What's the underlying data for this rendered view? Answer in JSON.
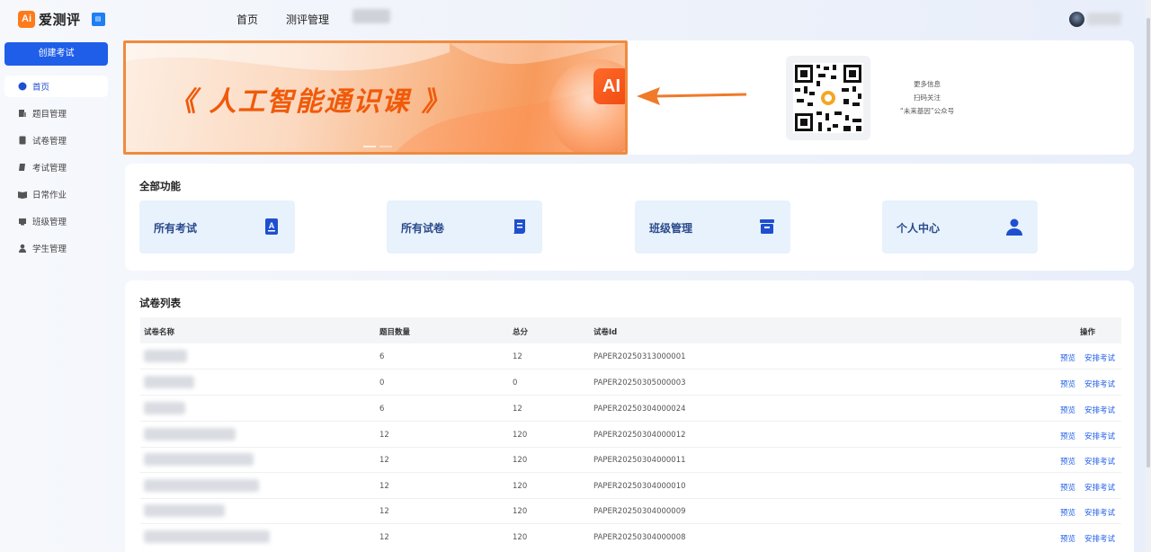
{
  "header": {
    "logo_mark": "Ai",
    "app_name": "爱测评",
    "nav": [
      {
        "label": "首页"
      },
      {
        "label": "测评管理"
      }
    ]
  },
  "sidebar": {
    "create_button": "创建考试",
    "items": [
      {
        "label": "首页",
        "icon": "home-icon",
        "active": true
      },
      {
        "label": "题目管理",
        "icon": "question-bank-icon"
      },
      {
        "label": "试卷管理",
        "icon": "paper-icon"
      },
      {
        "label": "考试管理",
        "icon": "exam-icon"
      },
      {
        "label": "日常作业",
        "icon": "homework-icon"
      },
      {
        "label": "班级管理",
        "icon": "class-icon"
      },
      {
        "label": "学生管理",
        "icon": "student-icon"
      }
    ]
  },
  "banner": {
    "title": "《 人工智能通识课 》",
    "badge": "AI"
  },
  "qr_panel": {
    "lines": [
      "更多信息",
      "扫码关注",
      "“未来基因”公众号"
    ]
  },
  "functions": {
    "title": "全部功能",
    "tiles": [
      {
        "label": "所有考试",
        "icon": "exam-doc-icon"
      },
      {
        "label": "所有试卷",
        "icon": "scroll-icon"
      },
      {
        "label": "班级管理",
        "icon": "class-box-icon"
      },
      {
        "label": "个人中心",
        "icon": "user-icon"
      }
    ]
  },
  "paper_list": {
    "title": "试卷列表",
    "columns": [
      "试卷名称",
      "题目数量",
      "总分",
      "试卷Id",
      "操作"
    ],
    "action_preview": "预览",
    "action_schedule": "安排考试",
    "rows": [
      {
        "count": "6",
        "score": "12",
        "id": "PAPER20250313000001"
      },
      {
        "count": "0",
        "score": "0",
        "id": "PAPER20250305000003"
      },
      {
        "count": "6",
        "score": "12",
        "id": "PAPER20250304000024"
      },
      {
        "count": "12",
        "score": "120",
        "id": "PAPER20250304000012"
      },
      {
        "count": "12",
        "score": "120",
        "id": "PAPER20250304000011"
      },
      {
        "count": "12",
        "score": "120",
        "id": "PAPER20250304000010"
      },
      {
        "count": "12",
        "score": "120",
        "id": "PAPER20250304000009"
      },
      {
        "count": "12",
        "score": "120",
        "id": "PAPER20250304000008"
      }
    ]
  },
  "colors": {
    "primary": "#1f5ee8",
    "brand_orange": "#ff7a1a",
    "tile_bg": "#e8f2fd"
  }
}
